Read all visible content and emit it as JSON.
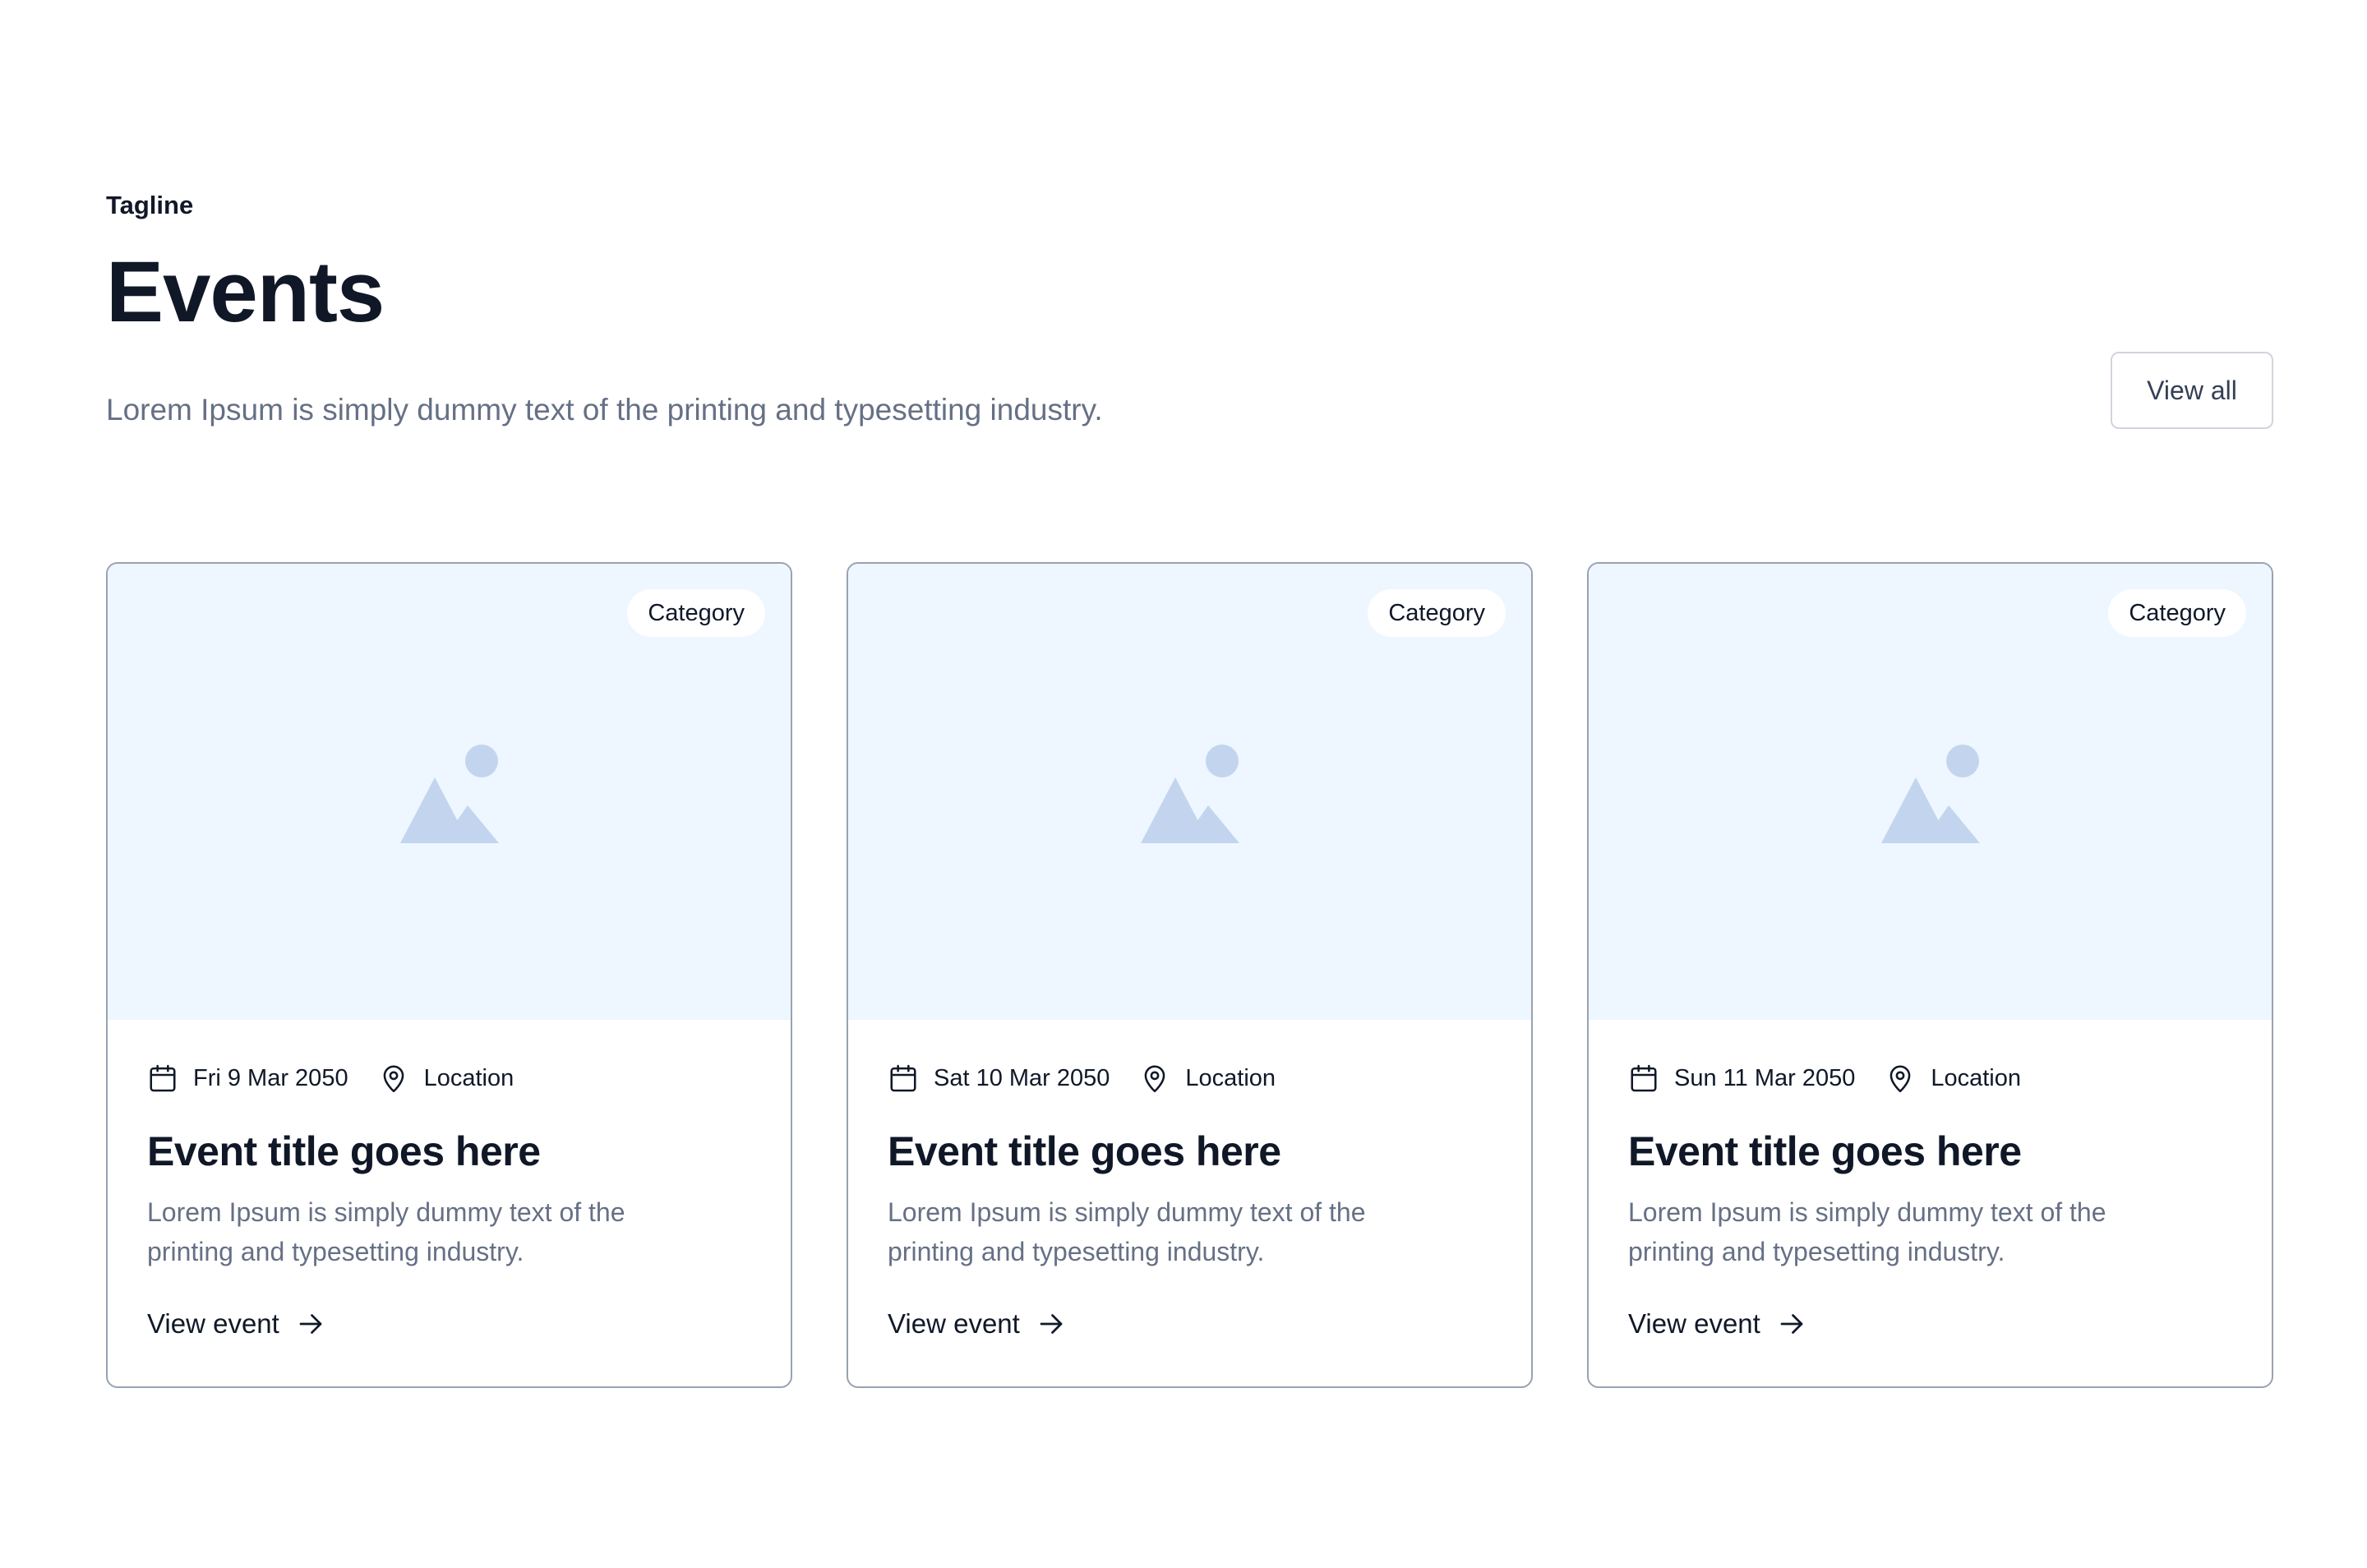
{
  "header": {
    "tagline": "Tagline",
    "title": "Events",
    "subtitle": "Lorem Ipsum is simply dummy text of the printing and typesetting industry.",
    "view_all_label": "View all"
  },
  "cards": [
    {
      "category": "Category",
      "date": "Fri 9 Mar 2050",
      "location": "Location",
      "title": "Event title goes here",
      "description": "Lorem Ipsum is simply dummy text of the printing and typesetting industry.",
      "link_label": "View event"
    },
    {
      "category": "Category",
      "date": "Sat 10 Mar 2050",
      "location": "Location",
      "title": "Event title goes here",
      "description": "Lorem Ipsum is simply dummy text of the printing and typesetting industry.",
      "link_label": "View event"
    },
    {
      "category": "Category",
      "date": "Sun 11 Mar 2050",
      "location": "Location",
      "title": "Event title goes here",
      "description": "Lorem Ipsum is simply dummy text of the printing and typesetting industry.",
      "link_label": "View event"
    }
  ],
  "icons": {
    "image": "image-placeholder-icon",
    "date": "calendar-icon",
    "location": "map-pin-icon",
    "link": "arrow-right-icon"
  },
  "colors": {
    "image_background": "#eef6ff",
    "placeholder_icon": "#c3d5ee",
    "heading": "#101828",
    "muted_text": "#667085",
    "card_border": "#98a2b3"
  }
}
